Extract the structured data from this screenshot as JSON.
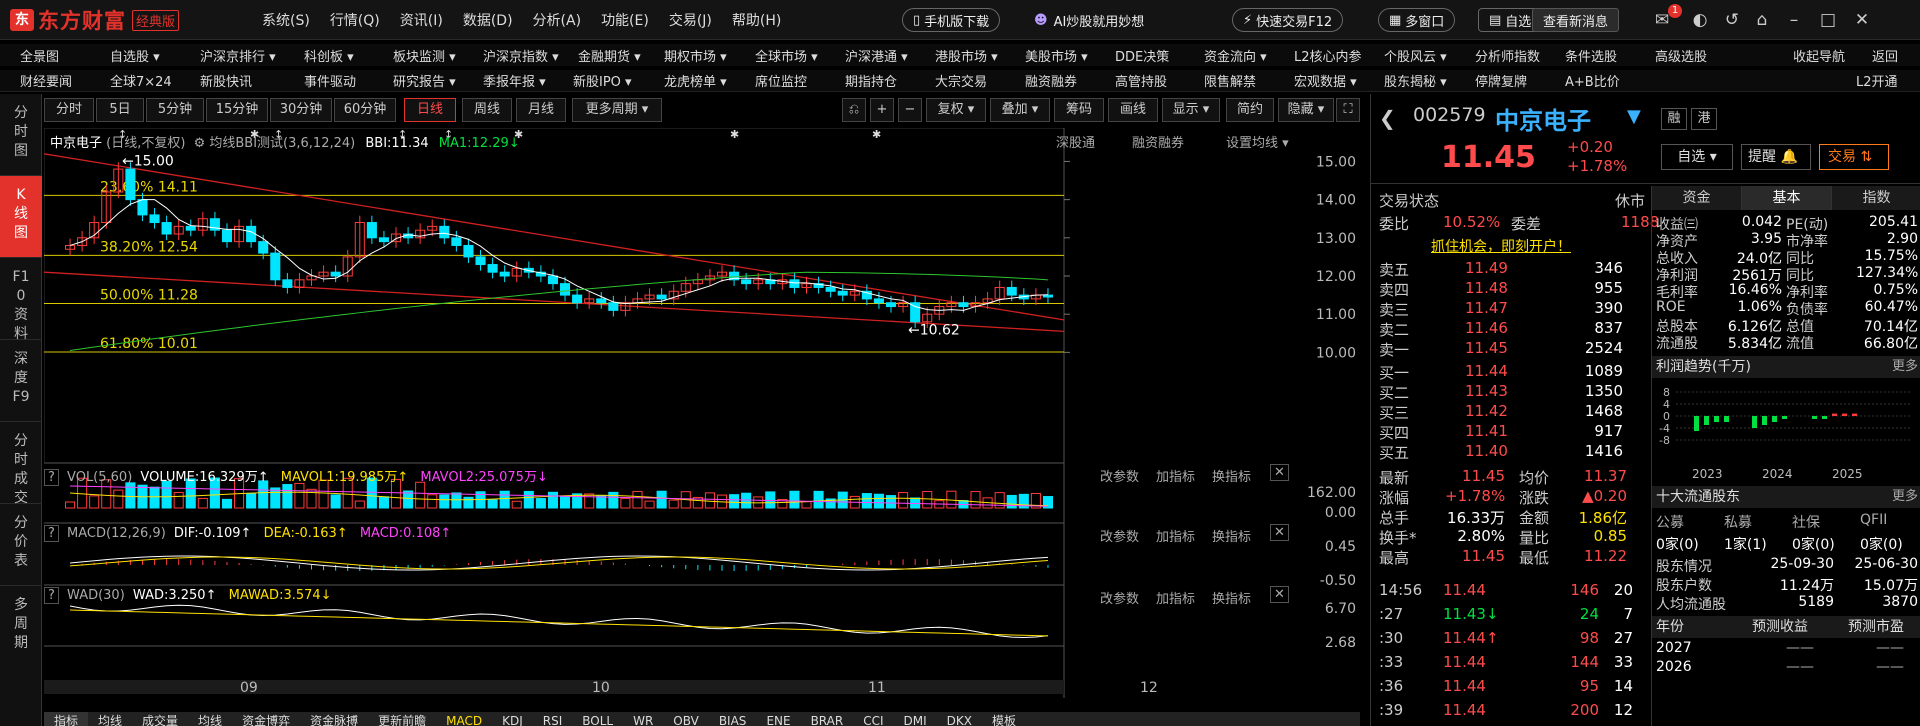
{
  "titlebar": {
    "brand": "东方财富",
    "edition": "经典版",
    "menu": [
      "系统(S)",
      "行情(Q)",
      "资讯(I)",
      "数据(D)",
      "分析(A)",
      "功能(E)",
      "交易(J)",
      "帮助(H)"
    ],
    "mobile_btn": "手机版下载",
    "ai_btn": "AI炒股就用妙想",
    "quick_trade": "快速交易F12",
    "multi_window": "多窗口",
    "self": "自选",
    "new_msg": "查看新消息",
    "badge": "1"
  },
  "nav1": [
    "全景图",
    "自选股 ▾",
    "沪深京排行 ▾",
    "科创板 ▾",
    "板块监测 ▾",
    "沪深京指数 ▾",
    "金融期货 ▾",
    "期权市场 ▾",
    "全球市场 ▾",
    "沪深港通 ▾",
    "港股市场 ▾",
    "美股市场 ▾",
    "DDE决策",
    "资金流向 ▾",
    "L2核心内参",
    "个股风云 ▾",
    "分析师指数",
    "条件选股",
    "高级选股",
    "收起导航",
    "返回"
  ],
  "nav2": [
    "财经要闻",
    "全球7×24",
    "新股快讯",
    "事件驱动",
    "研究报告 ▾",
    "季报年报 ▾",
    "新股IPO ▾",
    "龙虎榜单 ▾",
    "席位监控",
    "期指持仓",
    "大宗交易",
    "融资融券",
    "高管持股",
    "限售解禁",
    "宏观数据 ▾",
    "股东揭秘 ▾",
    "停牌复牌",
    "A+B比价",
    "L2开通"
  ],
  "leftbar": [
    "分时图",
    "K线图",
    "F10资料",
    "深度F9",
    "分时成交",
    "分价表",
    "多周期"
  ],
  "toolbar": {
    "periods": [
      "分时",
      "5日",
      "5分钟",
      "15分钟",
      "30分钟",
      "60分钟",
      "日线",
      "周线",
      "月线",
      "更多周期 ▾"
    ],
    "tools": [
      "复权 ▾",
      "叠加 ▾",
      "筹码",
      "画线",
      "显示 ▾",
      "简约",
      "隐藏 ▾"
    ]
  },
  "kline": {
    "title": "中京电子",
    "subtitle": "(日线,不复权)",
    "indicator": "均线BBI测试(3,6,12,24)",
    "bbi": "BBI:11.34",
    "ma1": "MA1:12.29",
    "links": [
      "深股通",
      "融资融券",
      "设置均线 ▾"
    ],
    "y_ticks": [
      "15.00",
      "14.00",
      "13.00",
      "12.00",
      "11.00",
      "10.00"
    ],
    "high_label": "15.00",
    "low_label": "10.62",
    "fib": [
      "23.60% 14.11",
      "38.20% 12.54",
      "50.00% 11.28",
      "61.80% 10.01"
    ],
    "x_ticks": [
      "09",
      "10",
      "11",
      "12"
    ]
  },
  "vol": {
    "name": "VOL(5,60)",
    "volume": "VOLUME:16.329万",
    "mavol1": "MAVOL1:19.985万",
    "mavol2": "MAVOL2:25.075万",
    "y_ticks": [
      "162.00",
      "0.00"
    ]
  },
  "macd": {
    "name": "MACD(12,26,9)",
    "dif": "DIF:-0.109",
    "dea": "DEA:-0.163",
    "macd": "MACD:0.108",
    "y_ticks": [
      "0.45",
      "-0.50"
    ]
  },
  "wad": {
    "name": "WAD(30)",
    "wad": "WAD:3.250",
    "mawad": "MAWAD:3.574",
    "y_ticks": [
      "6.70",
      "2.68"
    ]
  },
  "panel_links": [
    "改参数",
    "加指标",
    "换指标"
  ],
  "bottom_tabs": [
    "指标",
    "均线",
    "成交量",
    "均线",
    "资金博弈",
    "资金脉搏",
    "更新前瞻",
    "MACD",
    "KDJ",
    "RSI",
    "BOLL",
    "WR",
    "OBV",
    "BIAS",
    "ENE",
    "BRAR",
    "CCI",
    "DMI",
    "DKX",
    "模板"
  ],
  "quote": {
    "code": "002579",
    "name": "中京电子",
    "tags": [
      "融",
      "港"
    ],
    "price": "11.45",
    "change": "+0.20",
    "pct": "+1.78%",
    "watch": "自选 ▾",
    "remind": "提醒",
    "trade": "交易",
    "status_label": "交易状态",
    "status": "休市",
    "weibi_label": "委比",
    "weibi": "10.52%",
    "weicha_label": "委差",
    "weicha": "1188",
    "promo": "抓住机会，即刻开户！",
    "asks": [
      [
        "卖五",
        "11.49",
        "346"
      ],
      [
        "卖四",
        "11.48",
        "955"
      ],
      [
        "卖三",
        "11.47",
        "390"
      ],
      [
        "卖二",
        "11.46",
        "837"
      ],
      [
        "卖一",
        "11.45",
        "2524"
      ]
    ],
    "bids": [
      [
        "买一",
        "11.44",
        "1089"
      ],
      [
        "买二",
        "11.43",
        "1350"
      ],
      [
        "买三",
        "11.42",
        "1468"
      ],
      [
        "买四",
        "11.41",
        "917"
      ],
      [
        "买五",
        "11.40",
        "1416"
      ]
    ],
    "stats": [
      [
        "最新",
        "11.45",
        "均价",
        "11.37"
      ],
      [
        "涨幅",
        "+1.78%",
        "涨跌",
        "▲0.20"
      ],
      [
        "总手",
        "16.33万",
        "金额",
        "1.86亿"
      ],
      [
        "换手*",
        "2.80%",
        "量比",
        "0.85"
      ],
      [
        "最高",
        "11.45",
        "最低",
        "11.22"
      ]
    ],
    "ticks": [
      [
        "14:56",
        "11.44",
        "146",
        "20"
      ],
      [
        ":27",
        "11.43↓",
        "24",
        "7"
      ],
      [
        ":30",
        "11.44↑",
        "98",
        "27"
      ],
      [
        ":33",
        "11.44",
        "144",
        "33"
      ],
      [
        ":36",
        "11.44",
        "95",
        "14"
      ],
      [
        ":39",
        "11.44",
        "200",
        "12"
      ]
    ]
  },
  "fin": {
    "tabs": [
      "资金",
      "基本",
      "指数"
    ],
    "rows": [
      [
        "收益㈢",
        "0.042",
        "PE(动)",
        "205.41"
      ],
      [
        "净资产",
        "3.95",
        "市净率",
        "2.90"
      ],
      [
        "总收入",
        "24.0亿",
        "同比",
        "15.75%"
      ],
      [
        "净利润",
        "2561万",
        "同比",
        "127.34%"
      ],
      [
        "毛利率",
        "16.46%",
        "净利率",
        "0.75%"
      ],
      [
        "ROE",
        "1.06%",
        "负债率",
        "60.47%"
      ],
      [
        "总股本",
        "6.126亿",
        "总值",
        "70.14亿"
      ],
      [
        "流通股",
        "5.834亿",
        "流值",
        "66.80亿"
      ]
    ],
    "profit_title": "利润趋势(千万)",
    "more": "更多",
    "profit_y": [
      "8",
      "4",
      "0",
      "-4",
      "-8"
    ],
    "profit_x": [
      "2023",
      "2024",
      "2025"
    ],
    "holders_title": "十大流通股东",
    "holder_types": [
      "公募",
      "私募",
      "社保",
      "QFII"
    ],
    "holder_vals": [
      "0家(0)",
      "1家(1)",
      "0家(0)",
      "0家(0)"
    ],
    "holder_rows": [
      [
        "股东情况",
        "25-09-30",
        "25-06-30"
      ],
      [
        "股东户数",
        "11.24万",
        "15.07万"
      ],
      [
        "人均流通股",
        "5189",
        "3870"
      ]
    ],
    "forecast_hdr": [
      "年份",
      "预测收益",
      "预测市盈"
    ],
    "forecast": [
      [
        "2027",
        "——",
        "——"
      ],
      [
        "2026",
        "——",
        "——"
      ]
    ]
  },
  "chart_data": {
    "type": "candlestick",
    "instrument": "002579 中京电子",
    "period": "日线",
    "x_ticks": [
      "09",
      "10",
      "11",
      "12"
    ],
    "ylim": [
      9.8,
      15.3
    ],
    "annotations": {
      "high": 15.0,
      "low": 10.62
    },
    "fib_levels": [
      {
        "pct": "23.60%",
        "value": 14.11
      },
      {
        "pct": "38.20%",
        "value": 12.54
      },
      {
        "pct": "50.00%",
        "value": 11.28
      },
      {
        "pct": "61.80%",
        "value": 10.01
      }
    ],
    "last": {
      "close": 11.45,
      "bbi": 11.34,
      "ma1": 12.29
    }
  }
}
